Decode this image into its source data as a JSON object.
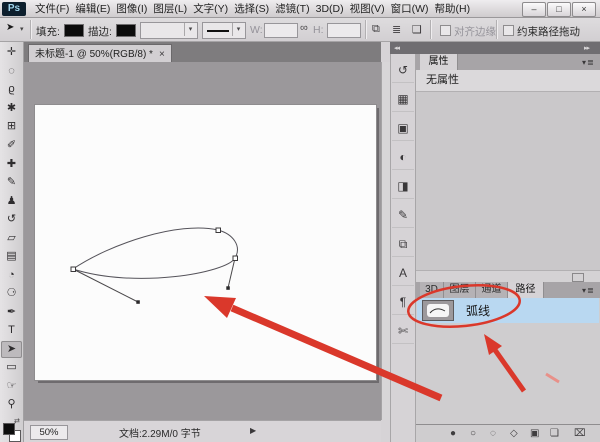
{
  "window": {
    "logo_text": "Ps",
    "minimize_label": "–",
    "maximize_label": "□",
    "close_label": "×"
  },
  "glyphs": {
    "caret": "▾",
    "swap": "⇄"
  },
  "menu_bar": {
    "items": [
      {
        "label": "文件(F)"
      },
      {
        "label": "编辑(E)"
      },
      {
        "label": "图像(I)"
      },
      {
        "label": "图层(L)"
      },
      {
        "label": "文字(Y)"
      },
      {
        "label": "选择(S)"
      },
      {
        "label": "滤镜(T)"
      },
      {
        "label": "3D(D)"
      },
      {
        "label": "视图(V)"
      },
      {
        "label": "窗口(W)"
      },
      {
        "label": "帮助(H)"
      }
    ]
  },
  "options_bar": {
    "tool_icon": "➤",
    "fill_label": "填充:",
    "stroke_label": "描边:",
    "w_label": "W:",
    "w_value": "",
    "link_icon": "∞",
    "h_label": "H:",
    "h_value": "",
    "path_ops": [
      {
        "name": "path-operations",
        "glyph": "⧉"
      },
      {
        "name": "path-alignment",
        "glyph": "≣"
      },
      {
        "name": "path-arrangement",
        "glyph": "❑"
      }
    ],
    "align_edges_label": "对齐边缘",
    "constrain_drag_label": "约束路径拖动"
  },
  "toolbar": {
    "tools": [
      {
        "name": "move-tool",
        "glyph": "✛"
      },
      {
        "name": "marquee-tool",
        "glyph": "◌"
      },
      {
        "name": "lasso-tool",
        "glyph": "ϱ"
      },
      {
        "name": "quick-selection-tool",
        "glyph": "✱"
      },
      {
        "name": "crop-tool",
        "glyph": "⊞"
      },
      {
        "name": "eyedropper-tool",
        "glyph": "✐"
      },
      {
        "name": "healing-brush-tool",
        "glyph": "✚"
      },
      {
        "name": "brush-tool",
        "glyph": "✎"
      },
      {
        "name": "clone-stamp-tool",
        "glyph": "♟"
      },
      {
        "name": "history-brush-tool",
        "glyph": "↺"
      },
      {
        "name": "eraser-tool",
        "glyph": "▱"
      },
      {
        "name": "gradient-tool",
        "glyph": "▤"
      },
      {
        "name": "blur-tool",
        "glyph": "◔"
      },
      {
        "name": "dodge-tool",
        "glyph": "⚆"
      },
      {
        "name": "pen-tool",
        "glyph": "✒"
      },
      {
        "name": "type-tool",
        "glyph": "T"
      },
      {
        "name": "path-selection-tool",
        "glyph": "➤",
        "selected": true
      },
      {
        "name": "rectangle-tool",
        "glyph": "▭"
      },
      {
        "name": "hand-tool",
        "glyph": "☞"
      },
      {
        "name": "zoom-tool",
        "glyph": "⚲"
      }
    ]
  },
  "document": {
    "tab_title": "未标题-1 @ 50%(RGB/8) *",
    "tab_close": "×",
    "zoom_value": "50%",
    "doc_info": "文档:2.29M/0 字节",
    "status_expand": "▶"
  },
  "dock": {
    "collapse_left": "◂◂",
    "collapse_right": "▸▸",
    "icons": [
      {
        "name": "history-panel-icon",
        "glyph": "↺"
      },
      {
        "name": "swatches-panel-icon",
        "glyph": "▦"
      },
      {
        "name": "libraries-panel-icon",
        "glyph": "▣"
      },
      {
        "name": "adjustments-panel-icon",
        "glyph": "◐"
      },
      {
        "name": "styles-panel-icon",
        "glyph": "◨"
      },
      {
        "name": "brush-settings-panel-icon",
        "glyph": "✎"
      },
      {
        "name": "clone-source-panel-icon",
        "glyph": "⧉"
      },
      {
        "name": "character-panel-icon",
        "glyph": "A"
      },
      {
        "name": "paragraph-panel-icon",
        "glyph": "¶"
      },
      {
        "name": "measurement-panel-icon",
        "glyph": "✄"
      }
    ]
  },
  "properties_panel": {
    "tab_label": "属性",
    "menu_icon": "▾≣",
    "empty_text": "无属性"
  },
  "paths_panel": {
    "tabs": [
      {
        "label": "3D"
      },
      {
        "label": "图层"
      },
      {
        "label": "通道"
      },
      {
        "label": "路径",
        "active": true
      }
    ],
    "menu_icon": "▾≣",
    "item": {
      "label": "弧线",
      "selected": true
    },
    "buttons": [
      {
        "name": "fill-path-button",
        "glyph": "●"
      },
      {
        "name": "stroke-path-button",
        "glyph": "○"
      },
      {
        "name": "load-selection-button",
        "glyph": "◌"
      },
      {
        "name": "make-work-path-button",
        "glyph": "◇"
      },
      {
        "name": "add-mask-button",
        "glyph": "▣"
      },
      {
        "name": "new-path-button",
        "glyph": "❏"
      },
      {
        "name": "delete-path-button",
        "glyph": "⌧"
      }
    ]
  },
  "annotations": {
    "red": "#da382b",
    "selection_blue": "#b9d8f1"
  }
}
